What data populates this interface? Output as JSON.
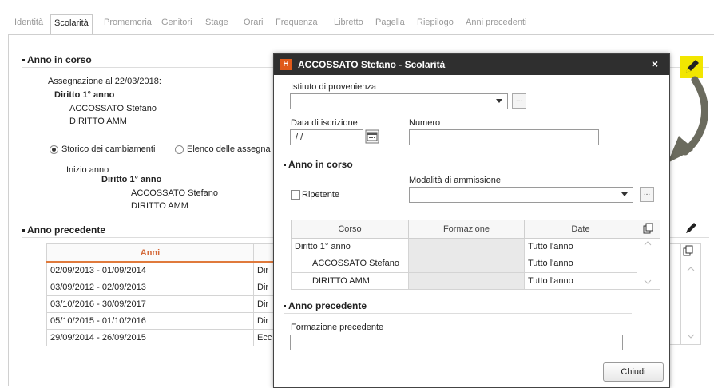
{
  "tabs": [
    "Identità",
    "Scolarità",
    "Promemoria",
    "Genitori",
    "Stage",
    "Orari",
    "Frequenza",
    "Libretto",
    "Pagella",
    "Riepilogo",
    "Anni precedenti"
  ],
  "active_tab": "Scolarità",
  "current_year": {
    "heading": "Anno in corso",
    "assignment_label": "Assegnazione al 22/03/2018:",
    "right": "Diritto 1° anno",
    "name": "ACCOSSATO Stefano",
    "course": "DIRITTO AMM",
    "radio_history": "Storico dei cambiamenti",
    "radio_list": "Elenco delle assegna",
    "start_label": "Inizio anno",
    "start_right": "Diritto 1° anno",
    "start_name": "ACCOSSATO Stefano",
    "start_course": "DIRITTO AMM"
  },
  "previous_year": {
    "heading": "Anno precedente",
    "column_years": "Anni",
    "rows": [
      {
        "years": "02/09/2013 - 01/09/2014",
        "value": "Dir"
      },
      {
        "years": "03/09/2012 - 02/09/2013",
        "value": "Dir"
      },
      {
        "years": "03/10/2016 - 30/09/2017",
        "value": "Dir"
      },
      {
        "years": "05/10/2015 - 01/10/2016",
        "value": "Dir"
      },
      {
        "years": "29/09/2014 - 26/09/2015",
        "value": "Ecc"
      }
    ]
  },
  "dialog": {
    "title": "ACCOSSATO Stefano - Scolarità",
    "logo": "H",
    "close": "×",
    "origin_label": "Istituto di provenienza",
    "date_label": "Data di iscrizione",
    "date_value": "/ /",
    "number_label": "Numero",
    "current_heading": "Anno in corso",
    "admission_label": "Modalità di ammissione",
    "repeat_label": "Ripetente",
    "dots": "...",
    "table_headers": [
      "Corso",
      "Formazione",
      "Date"
    ],
    "table_rows": [
      {
        "corso": "Diritto 1° anno",
        "formazione": "",
        "date": "Tutto l'anno"
      },
      {
        "corso": "ACCOSSATO Stefano",
        "formazione": "",
        "date": "Tutto l'anno"
      },
      {
        "corso": "DIRITTO AMM",
        "formazione": "",
        "date": "Tutto l'anno"
      }
    ],
    "previous_heading": "Anno precedente",
    "prev_training_label": "Formazione precedente",
    "close_button": "Chiudi"
  },
  "colors": {
    "accent": "#e07a3c",
    "titlebar": "#2f2f2f",
    "highlight": "#f2e600",
    "arrow": "#6b6b5e"
  }
}
